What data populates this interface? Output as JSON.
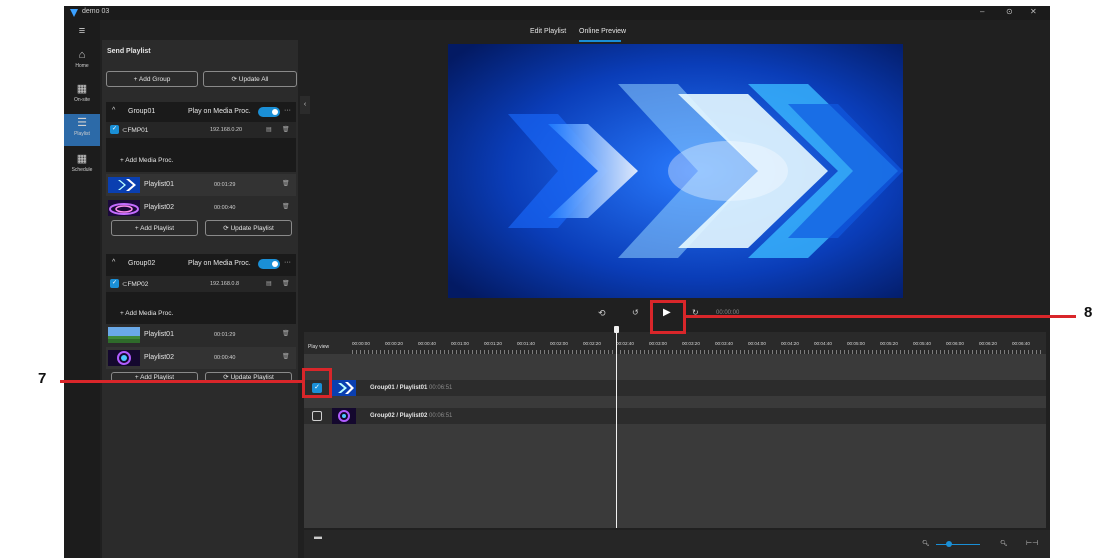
{
  "app": {
    "title": "demo 03"
  },
  "window_controls": {
    "minimize": "–",
    "restore": "⊙",
    "close": "✕"
  },
  "rail": {
    "menu_icon": "≡",
    "items": [
      {
        "label": "Home",
        "icon": "home-icon",
        "glyph": "⌂"
      },
      {
        "label": "On-site",
        "icon": "grid-icon",
        "glyph": "▦"
      },
      {
        "label": "Playlist",
        "icon": "playlist-icon",
        "glyph": "☰",
        "active": true
      },
      {
        "label": "Schedule",
        "icon": "schedule-icon",
        "glyph": "▦"
      }
    ]
  },
  "left_panel": {
    "title": "Send Playlist",
    "add_group_label": "+ Add Group",
    "update_all_label": "⟳ Update All",
    "groups": [
      {
        "name": "Group01",
        "play_label": "Play on Media Proc.",
        "processor": {
          "name": "⊂FMP01",
          "ip": "192.168.0.20"
        },
        "add_proc_label": "+ Add Media Proc.",
        "playlists": [
          {
            "name": "Playlist01",
            "duration": "00:01:29"
          },
          {
            "name": "Playlist02",
            "duration": "00:00:40"
          }
        ],
        "add_playlist_label": "+ Add Playlist",
        "update_playlist_label": "⟳ Update Playlist"
      },
      {
        "name": "Group02",
        "play_label": "Play on Media Proc.",
        "processor": {
          "name": "⊂FMP02",
          "ip": "192.168.0.8"
        },
        "add_proc_label": "+ Add Media Proc.",
        "playlists": [
          {
            "name": "Playlist01",
            "duration": "00:01:29"
          },
          {
            "name": "Playlist02",
            "duration": "00:00:40"
          }
        ],
        "add_playlist_label": "+ Add Playlist",
        "update_playlist_label": "⟳ Update Playlist"
      }
    ]
  },
  "tabs": [
    {
      "label": "Edit Playlist"
    },
    {
      "label": "Online Preview",
      "active": true
    }
  ],
  "transport": {
    "time": "00:00:00"
  },
  "timeline": {
    "label": "Play view",
    "ticks": [
      "00:00:00",
      "00:00:20",
      "00:00:40",
      "00:01:00",
      "00:01:20",
      "00:01:40",
      "00:02:00",
      "00:02:20",
      "00:02:40",
      "00:03:00",
      "00:03:20",
      "00:03:40",
      "00:04:00",
      "00:04:20",
      "00:04:40",
      "00:05:00",
      "00:05:20",
      "00:05:40",
      "00:06:00",
      "00:06:20",
      "00:06:40"
    ],
    "tracks": [
      {
        "title": "Group01 / Playlist01",
        "duration": "00:06:51",
        "checked": true
      },
      {
        "title": "Group02 / Playlist02",
        "duration": "00:06:51",
        "checked": false
      }
    ]
  },
  "callouts": [
    {
      "number": "7"
    },
    {
      "number": "8"
    }
  ],
  "colors": {
    "accent": "#1a8fd6",
    "callout": "#d9262a"
  }
}
